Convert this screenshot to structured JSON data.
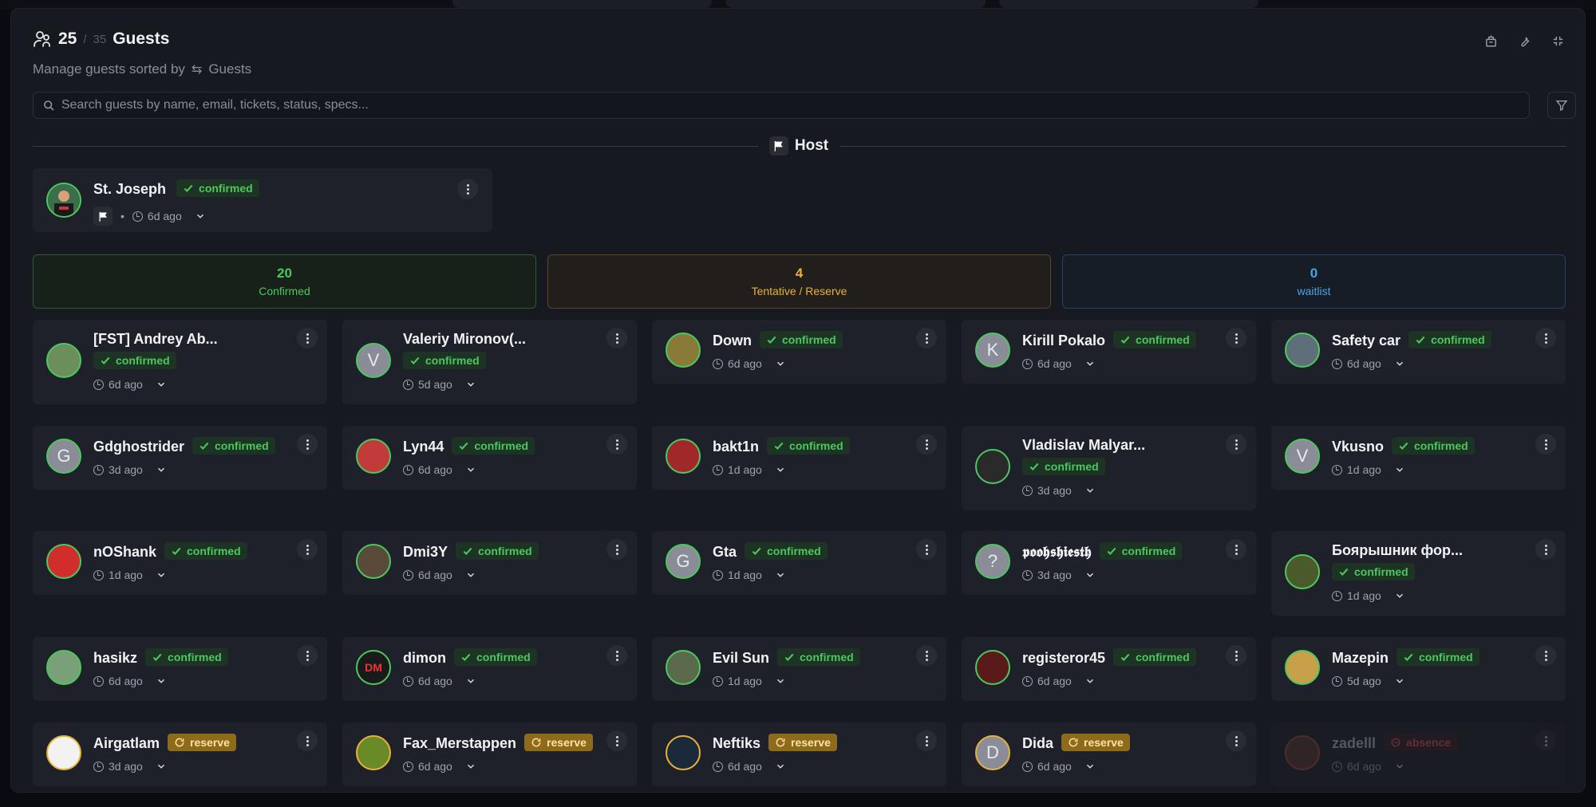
{
  "header": {
    "count": "25",
    "slash": "/",
    "total": "35",
    "title": "Guests",
    "subtitle_prefix": "Manage guests sorted by",
    "sort_label": "Guests"
  },
  "search": {
    "placeholder": "Search guests by name, email, tickets, status, specs..."
  },
  "host_section": {
    "label": "Host"
  },
  "host": {
    "name": "St. Joseph",
    "status": "confirmed",
    "time": "6d ago",
    "separator": "•"
  },
  "summary": {
    "confirmed": {
      "count": "20",
      "label": "Confirmed"
    },
    "tentative": {
      "count": "4",
      "label": "Tentative / Reserve"
    },
    "waitlist": {
      "count": "0",
      "label": "waitlist"
    }
  },
  "colors": {
    "confirmed": "#4cc85f",
    "reserve": "#e8b23a",
    "waitlist": "#4aa3e8",
    "absence": "#d0545e",
    "background": "#171921"
  },
  "guests": [
    {
      "name": "[FST] Andrey Ab...",
      "status": "confirmed",
      "time": "6d ago",
      "avatar": ""
    },
    {
      "name": "Valeriy Mironov(...",
      "status": "confirmed",
      "time": "5d ago",
      "avatar": "V"
    },
    {
      "name": "Down",
      "status": "confirmed",
      "time": "6d ago",
      "avatar": ""
    },
    {
      "name": "Kirill Pokalo",
      "status": "confirmed",
      "time": "6d ago",
      "avatar": "K"
    },
    {
      "name": "Safety car",
      "status": "confirmed",
      "time": "6d ago",
      "avatar": ""
    },
    {
      "name": "Gdghostrider",
      "status": "confirmed",
      "time": "3d ago",
      "avatar": "G"
    },
    {
      "name": "Lyn44",
      "status": "confirmed",
      "time": "6d ago",
      "avatar": ""
    },
    {
      "name": "bakt1n",
      "status": "confirmed",
      "time": "1d ago",
      "avatar": ""
    },
    {
      "name": "Vladislav Malyar...",
      "status": "confirmed",
      "time": "3d ago",
      "avatar": ""
    },
    {
      "name": "Vkusno",
      "status": "confirmed",
      "time": "1d ago",
      "avatar": "V"
    },
    {
      "name": "nOShank",
      "status": "confirmed",
      "time": "1d ago",
      "avatar": ""
    },
    {
      "name": "Dmi3Y",
      "status": "confirmed",
      "time": "6d ago",
      "avatar": ""
    },
    {
      "name": "Gta",
      "status": "confirmed",
      "time": "1d ago",
      "avatar": "G"
    },
    {
      "name": "𝖕𝖔𝖔𝖍𝖘𝖍𝖎𝖊𝖘𝖙𝖍",
      "status": "confirmed",
      "time": "3d ago",
      "avatar": "?"
    },
    {
      "name": "Боярышник фор...",
      "status": "confirmed",
      "time": "1d ago",
      "avatar": ""
    },
    {
      "name": "hasikz",
      "status": "confirmed",
      "time": "6d ago",
      "avatar": ""
    },
    {
      "name": "dimon",
      "status": "confirmed",
      "time": "6d ago",
      "avatar": "DM"
    },
    {
      "name": "Evil Sun",
      "status": "confirmed",
      "time": "1d ago",
      "avatar": ""
    },
    {
      "name": "registeror45",
      "status": "confirmed",
      "time": "6d ago",
      "avatar": ""
    },
    {
      "name": "Mazepin",
      "status": "confirmed",
      "time": "5d ago",
      "avatar": ""
    },
    {
      "name": "Airgatlam",
      "status": "reserve",
      "time": "3d ago",
      "avatar": ""
    },
    {
      "name": "Fax_Merstappen",
      "status": "reserve",
      "time": "6d ago",
      "avatar": ""
    },
    {
      "name": "Neftiks",
      "status": "reserve",
      "time": "6d ago",
      "avatar": ""
    },
    {
      "name": "Dida",
      "status": "reserve",
      "time": "6d ago",
      "avatar": "D"
    },
    {
      "name": "zadelll",
      "status": "absence",
      "time": "6d ago",
      "avatar": ""
    }
  ]
}
